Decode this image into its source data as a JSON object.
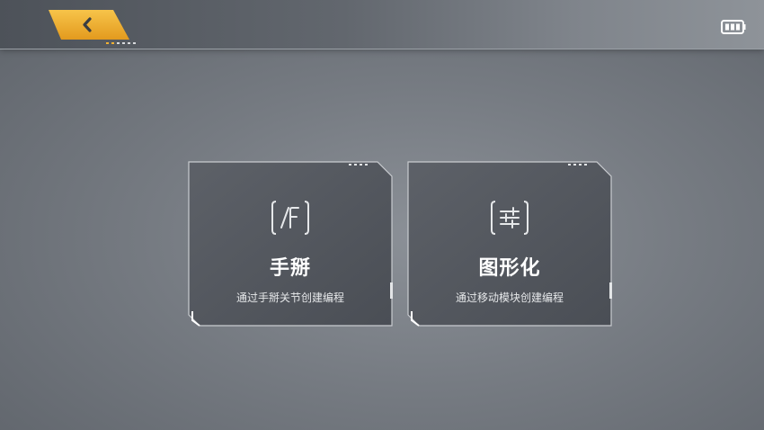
{
  "topbar": {
    "back_icon": "chevron-left-icon",
    "battery_icon": "battery-icon",
    "accent_color": "#f2b233"
  },
  "cards": [
    {
      "icon": "function-icon",
      "title": "手掰",
      "desc": "通过手掰关节创建编程"
    },
    {
      "icon": "sliders-icon",
      "title": "图形化",
      "desc": "通过移动模块创建编程"
    }
  ]
}
